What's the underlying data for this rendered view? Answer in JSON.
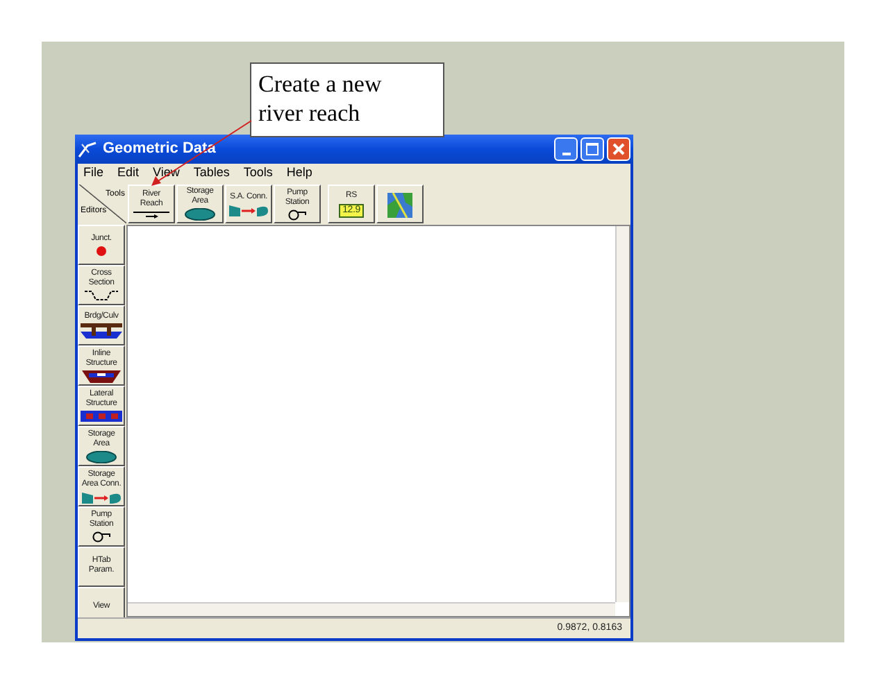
{
  "callout": {
    "text": "Create a new river reach"
  },
  "window": {
    "title": "Geometric Data"
  },
  "menu": [
    "File",
    "Edit",
    "View",
    "Tables",
    "Tools",
    "Help"
  ],
  "toolbar": {
    "corner_top": "Tools",
    "corner_bottom": "Editors",
    "tools": [
      {
        "label": "River Reach",
        "kind": "line"
      },
      {
        "label": "Storage Area",
        "kind": "blob"
      },
      {
        "label": "S.A. Conn.",
        "kind": "conn"
      },
      {
        "label": "Pump Station",
        "kind": "pump"
      },
      {
        "label": "RS",
        "kind": "tag",
        "tag": "12.9"
      },
      {
        "kind": "map"
      }
    ]
  },
  "editors": [
    {
      "label": "Junct.",
      "kind": "dot"
    },
    {
      "label": "Cross Section",
      "kind": "section"
    },
    {
      "label": "Brdg/Culv",
      "kind": "bridge"
    },
    {
      "label": "Inline Structure",
      "kind": "inline"
    },
    {
      "label": "Lateral Structure",
      "kind": "lateral"
    },
    {
      "label": "Storage Area",
      "kind": "blob"
    },
    {
      "label": "Storage Area Conn.",
      "kind": "conn"
    },
    {
      "label": "Pump Station",
      "kind": "pump"
    },
    {
      "label": "HTab Param.",
      "kind": "none"
    },
    {
      "label": "View",
      "kind": "none"
    }
  ],
  "status_bar": {
    "coordinates": "0.9872, 0.8163"
  }
}
